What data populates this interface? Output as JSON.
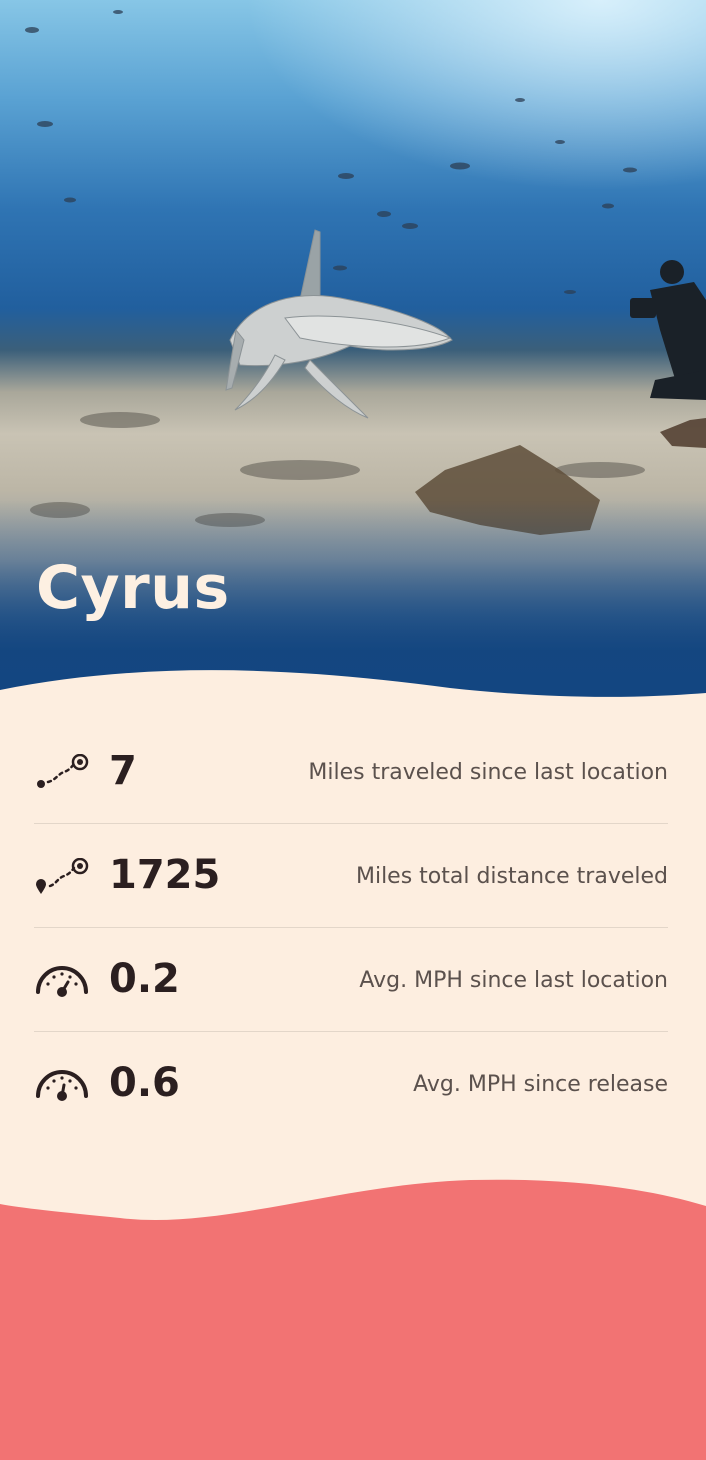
{
  "hero": {
    "title": "Cyrus",
    "image": "hammerhead-shark-underwater-photo"
  },
  "stats": [
    {
      "icon": "route-distance-icon",
      "value": "7",
      "label": "Miles traveled since last location"
    },
    {
      "icon": "route-total-icon",
      "value": "1725",
      "label": "Miles total distance traveled"
    },
    {
      "icon": "speedometer-icon",
      "value": "0.2",
      "label": "Avg. MPH since last location"
    },
    {
      "icon": "speedometer-icon",
      "value": "0.6",
      "label": "Avg. MPH since release"
    }
  ],
  "colors": {
    "panel_bg": "#fdeee0",
    "footer_bg": "#f27373",
    "hero_deep_blue": "#134681",
    "text_dark": "#2b1f20",
    "text_muted": "#5b514d"
  }
}
